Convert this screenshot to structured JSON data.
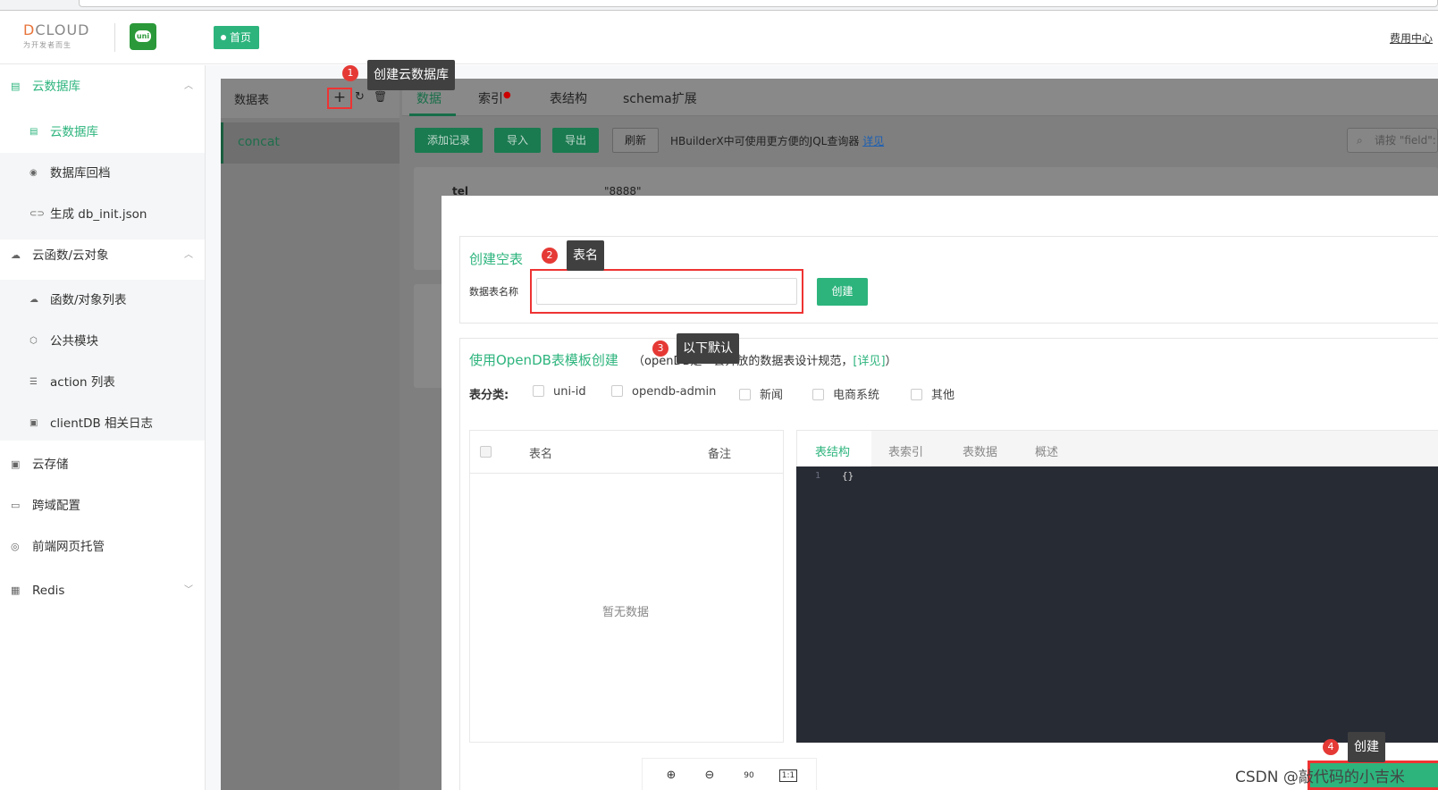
{
  "header": {
    "logo_word": "DCLOUD",
    "logo_sub": "为开发者而生",
    "uni_badge": "uni",
    "home_tab": "首页",
    "fee_link": "费用中心"
  },
  "sidebar": {
    "groups": [
      {
        "label": "云数据库",
        "icon": "database-icon",
        "expanded": true
      },
      {
        "label": "云函数/云对象",
        "icon": "cloud-icon",
        "expanded": true
      },
      {
        "label": "云存储",
        "icon": "storage-icon"
      },
      {
        "label": "跨域配置",
        "icon": "monitor-icon"
      },
      {
        "label": "前端网页托管",
        "icon": "webhost-icon"
      },
      {
        "label": "Redis",
        "icon": "redis-icon",
        "expanded": false
      }
    ],
    "db_items": [
      {
        "label": "云数据库",
        "icon": "database-icon"
      },
      {
        "label": "数据库回档",
        "icon": "rollback-icon"
      },
      {
        "label": "生成 db_init.json",
        "icon": "link-icon"
      }
    ],
    "fn_items": [
      {
        "label": "函数/对象列表",
        "icon": "cloud-icon"
      },
      {
        "label": "公共模块",
        "icon": "cube-icon"
      },
      {
        "label": "action 列表",
        "icon": "list-icon"
      },
      {
        "label": "clientDB 相关日志",
        "icon": "log-icon"
      }
    ]
  },
  "tables_panel": {
    "title": "数据表",
    "add_icon": "+",
    "tables": [
      "concat"
    ]
  },
  "tabs": [
    "数据",
    "索引",
    "表结构",
    "schema扩展"
  ],
  "toolbar": {
    "add_record": "添加记录",
    "import": "导入",
    "export": "导出",
    "refresh": "刷新",
    "hint": "HBuilderX中可使用更方便的JQL查询器",
    "hint_link": "详见",
    "search_placeholder": "请按 \"field\":"
  },
  "record": {
    "key": "tel",
    "value": "\"8888\""
  },
  "dialog": {
    "empty_title": "创建空表",
    "name_label": "数据表名称",
    "name_value": "",
    "create_btn": "创建",
    "opendb_title": "使用OpenDB表模板创建",
    "opendb_desc_prefix": "（openDB是一套开放的数据表设计规范，",
    "opendb_desc_link": "[详见]",
    "opendb_desc_suffix": "）",
    "category_label": "表分类:",
    "categories": [
      "uni-id",
      "opendb-admin",
      "新闻",
      "电商系统",
      "其他"
    ],
    "list_col_name": "表名",
    "list_col_note": "备注",
    "empty_text": "暂无数据",
    "preview_tabs": [
      "表结构",
      "表索引",
      "表数据",
      "概述"
    ],
    "code_line_no": "1",
    "code_text": "{}"
  },
  "zoom": [
    "zoom-in-icon",
    "zoom-out-icon",
    "rotate-icon",
    "actual-size-icon"
  ],
  "zoom_labels": {
    "rotate": "90",
    "actual": "1:1"
  },
  "annotations": [
    {
      "num": "1",
      "text": "创建云数据库"
    },
    {
      "num": "2",
      "text": "表名"
    },
    {
      "num": "3",
      "text": "以下默认"
    },
    {
      "num": "4",
      "text": "创建"
    }
  ],
  "watermark": "CSDN @敲代码的小吉米",
  "colors": {
    "accent": "#2db47d",
    "annotation_red": "#e53935",
    "code_bg": "#272b34"
  }
}
